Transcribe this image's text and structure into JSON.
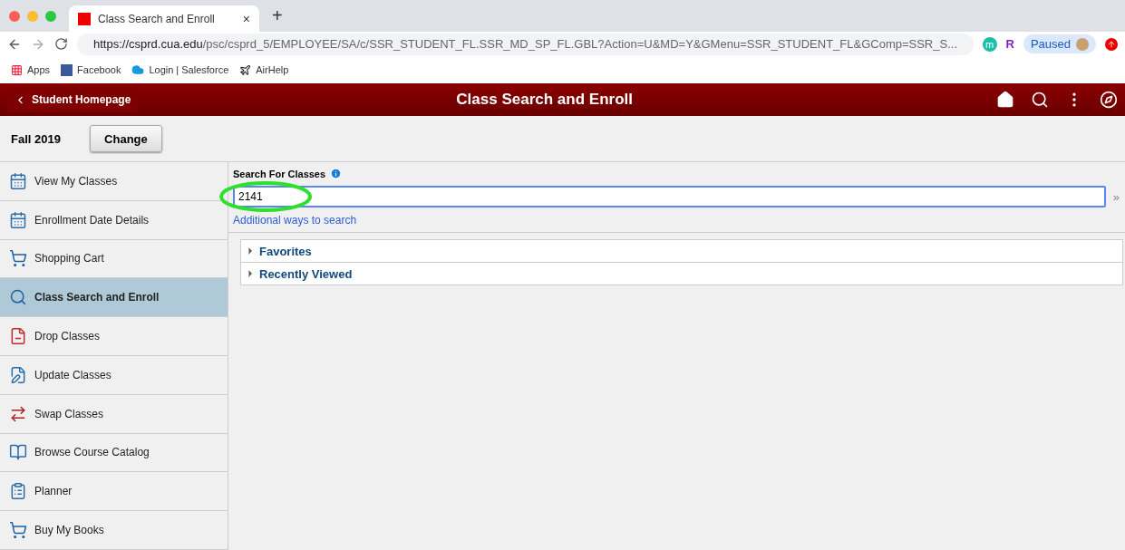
{
  "browser": {
    "tab": {
      "title": "Class Search and Enroll",
      "close": "×"
    },
    "new_tab": "+",
    "url_host": "https://csprd.cua.edu",
    "url_path": "/psc/csprd_5/EMPLOYEE/SA/c/SSR_STUDENT_FL.SSR_MD_SP_FL.GBL?Action=U&MD=Y&GMenu=SSR_STUDENT_FL&GComp=SSR_S...",
    "extension_letter": "m",
    "extension_r": "R",
    "profile": "Paused",
    "bookmarks": [
      {
        "kind": "apps",
        "label": "Apps"
      },
      {
        "kind": "facebook",
        "label": "Facebook"
      },
      {
        "kind": "cloud",
        "label": "Login | Salesforce"
      },
      {
        "kind": "airhelp",
        "label": "AirHelp"
      }
    ]
  },
  "header": {
    "back": "Student Homepage",
    "title": "Class Search and Enroll"
  },
  "term": {
    "label": "Fall 2019",
    "button": "Change"
  },
  "sidebar": {
    "items": [
      {
        "kind": "calendar-search",
        "label": "View My Classes",
        "selected": false
      },
      {
        "kind": "calendar",
        "label": "Enrollment Date Details",
        "selected": false
      },
      {
        "kind": "cart",
        "label": "Shopping Cart",
        "selected": false
      },
      {
        "kind": "search",
        "label": "Class Search and Enroll",
        "selected": true
      },
      {
        "kind": "drop",
        "label": "Drop Classes",
        "selected": false
      },
      {
        "kind": "edit",
        "label": "Update Classes",
        "selected": false
      },
      {
        "kind": "swap",
        "label": "Swap Classes",
        "selected": false
      },
      {
        "kind": "catalog",
        "label": "Browse Course Catalog",
        "selected": false
      },
      {
        "kind": "planner",
        "label": "Planner",
        "selected": false
      },
      {
        "kind": "cart",
        "label": "Buy My Books",
        "selected": false
      }
    ]
  },
  "search": {
    "label": "Search For Classes",
    "value": "2141",
    "go": "»",
    "link": "Additional ways to search",
    "highlighted": true
  },
  "sections": [
    {
      "label": "Favorites",
      "expanded": false
    },
    {
      "label": "Recently Viewed",
      "expanded": false
    }
  ]
}
